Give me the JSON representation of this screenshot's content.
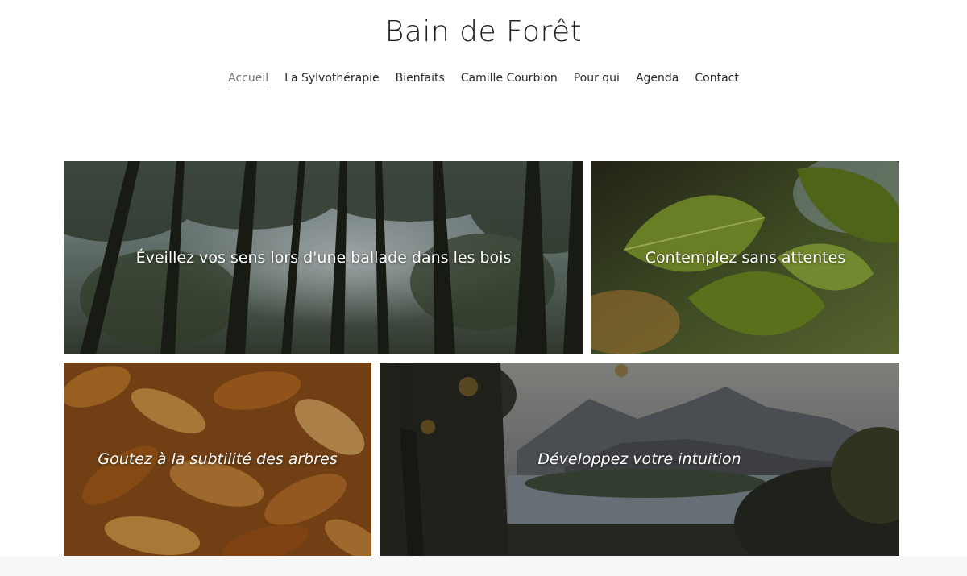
{
  "site": {
    "title": "Bain de Forêt"
  },
  "nav": {
    "items": [
      {
        "label": "Accueil",
        "active": true
      },
      {
        "label": "La Sylvothérapie",
        "active": false
      },
      {
        "label": "Bienfaits",
        "active": false
      },
      {
        "label": "Camille Courbion",
        "active": false
      },
      {
        "label": "Pour qui",
        "active": false
      },
      {
        "label": "Agenda",
        "active": false
      },
      {
        "label": "Contact",
        "active": false
      }
    ]
  },
  "gallery": {
    "tiles": [
      {
        "caption": "Éveillez vos sens lors d'une ballade dans les bois",
        "image": "forest-canopy"
      },
      {
        "caption": "Contemplez sans attentes",
        "image": "green-leaves"
      },
      {
        "caption": "Goutez à la subtilité des arbres",
        "image": "autumn-oak-leaves"
      },
      {
        "caption": "Développez votre intuition",
        "image": "mountain-lake"
      }
    ]
  }
}
